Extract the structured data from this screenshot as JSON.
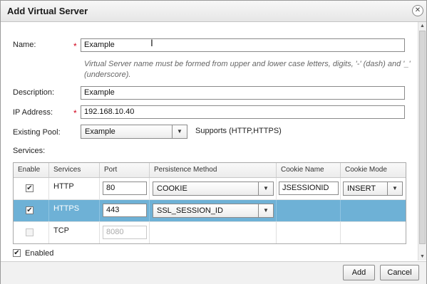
{
  "dialog": {
    "title": "Add Virtual Server",
    "close_icon": "close-icon"
  },
  "form": {
    "name_label": "Name:",
    "name_value": "Example",
    "name_hint": "Virtual Server name must be formed from upper and lower case letters, digits, '-' (dash) and '_' (underscore).",
    "description_label": "Description:",
    "description_value": "Example",
    "ip_label": "IP Address:",
    "ip_value": "192.168.10.40",
    "pool_label": "Existing Pool:",
    "pool_value": "Example",
    "pool_supports": "Supports (HTTP,HTTPS)",
    "services_label": "Services:",
    "required_mark": "*"
  },
  "services_table": {
    "headers": [
      "Enable",
      "Services",
      "Port",
      "Persistence Method",
      "Cookie Name",
      "Cookie Mode"
    ],
    "rows": [
      {
        "enabled": true,
        "service": "HTTP",
        "port": "80",
        "persistence": "COOKIE",
        "cookie_name": "JSESSIONID",
        "cookie_mode": "INSERT",
        "selected": false,
        "disabled": false
      },
      {
        "enabled": true,
        "service": "HTTPS",
        "port": "443",
        "persistence": "SSL_SESSION_ID",
        "cookie_name": "",
        "cookie_mode": "",
        "selected": true,
        "disabled": false
      },
      {
        "enabled": false,
        "service": "TCP",
        "port": "8080",
        "persistence": "",
        "cookie_name": "",
        "cookie_mode": "",
        "selected": false,
        "disabled": true
      }
    ]
  },
  "enabled_checkbox": {
    "label": "Enabled",
    "checked": true
  },
  "buttons": {
    "add": "Add",
    "cancel": "Cancel"
  },
  "icons": {
    "check": "✔",
    "dropdown": "▼",
    "scroll_up": "▲",
    "scroll_down": "▼"
  }
}
